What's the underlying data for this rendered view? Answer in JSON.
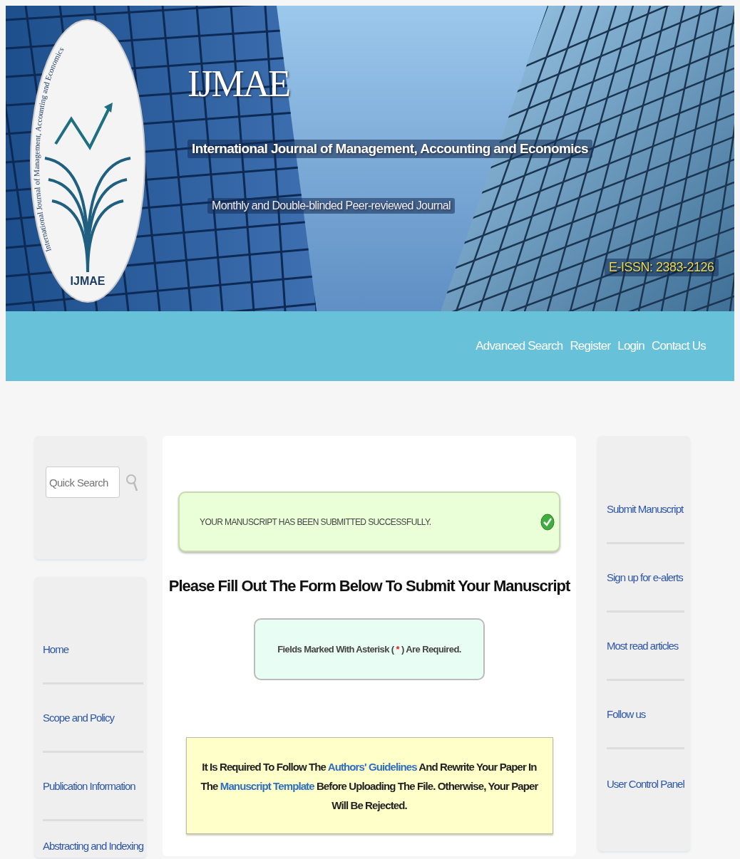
{
  "banner": {
    "logo_ring_text": "International Journal of Management, Accounting and Economics",
    "logo_text": "IJMAE",
    "title": "IJMAE",
    "subtitle": "International Journal of Management, Accounting and Economics",
    "tagline": "Monthly and Double-blinded Peer-reviewed Journal",
    "issn": "E-ISSN: 2383-2126"
  },
  "top_nav": [
    "Advanced Search",
    "Register",
    "Login",
    "Contact Us"
  ],
  "quick_search": {
    "placeholder": "Quick Search"
  },
  "left_menu": [
    "Home",
    "Scope and Policy",
    "Publication Information",
    "Abstracting and Indexing"
  ],
  "success_message": "YOUR MANUSCRIPT HAS BEEN SUBMITTED SUCCESSFULLY.",
  "form_heading": "Please Fill Out The Form Below To Submit Your Manuscript",
  "required_note": {
    "before": "Fields Marked With Asterisk ( ",
    "mark": "*",
    "after": " ) Are Required."
  },
  "guideline_note": [
    {
      "kind": "text",
      "text": "It Is Required To Follow The "
    },
    {
      "kind": "link",
      "text": "Authors' Guidelines"
    },
    {
      "kind": "text",
      "text": " And Rewrite Your Paper In The "
    },
    {
      "kind": "link",
      "text": "Manuscript Template"
    },
    {
      "kind": "text",
      "text": " Before Uploading The File. Otherwise, Your Paper Will Be Rejected."
    }
  ],
  "right_menu": [
    "Submit Manuscript",
    "Sign up for e-alerts",
    "Most read articles",
    "Follow us",
    "User Control Panel"
  ]
}
